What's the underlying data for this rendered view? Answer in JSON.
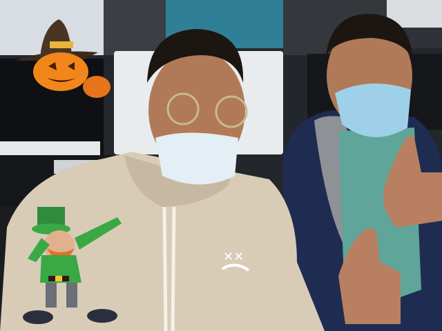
{
  "scene": {
    "kind": "webcam-frame",
    "colors": {
      "ceiling": "#2a2e31",
      "wall_teal": "#2f7f96",
      "floor_dark": "#17191d",
      "monitor_white": "#e9ecef",
      "hoodie": "#d8ccb7",
      "jacket_navy": "#1f2c52",
      "mask_blue": "#9fd0ea",
      "skin": "#b07a58",
      "hair": "#1c1612"
    }
  },
  "stickers": [
    {
      "name": "pumpkin-witch-hat-sticker",
      "icon": "jack-o-lantern-icon",
      "colors": {
        "pumpkin": "#f2861a",
        "hat": "#3a2a1e",
        "band": "#e8b53a"
      }
    },
    {
      "name": "leprechaun-dab-sticker",
      "icon": "leprechaun-icon",
      "colors": {
        "green": "#3aa845",
        "beard": "#e0702a",
        "buckle": "#f2c43a"
      }
    }
  ],
  "hoodie_print": {
    "text": "✕✕"
  }
}
